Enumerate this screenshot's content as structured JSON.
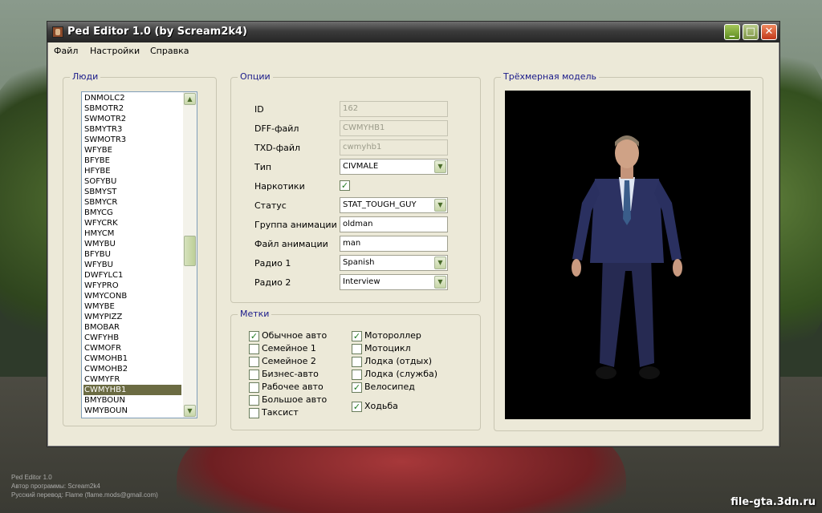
{
  "window": {
    "title": "Ped Editor 1.0 (by Scream2k4)",
    "minimize_label": "_",
    "maximize_label": "□",
    "close_label": "✕"
  },
  "menu": [
    "Файл",
    "Настройки",
    "Справка"
  ],
  "people": {
    "label": "Люди",
    "items": [
      "DNMOLC2",
      "SBMOTR2",
      "SWMOTR2",
      "SBMYTR3",
      "SWMOTR3",
      "WFYBE",
      "BFYBE",
      "HFYBE",
      "SOFYBU",
      "SBMYST",
      "SBMYCR",
      "BMYCG",
      "WFYCRK",
      "HMYCM",
      "WMYBU",
      "BFYBU",
      "WFYBU",
      "DWFYLC1",
      "WFYPRO",
      "WMYCONB",
      "WMYBE",
      "WMYPIZZ",
      "BMOBAR",
      "CWFYHB",
      "CWMOFR",
      "CWMOHB1",
      "CWMOHB2",
      "CWMYFR",
      "CWMYHB1",
      "BMYBOUN",
      "WMYBOUN"
    ],
    "selected": "CWMYHB1",
    "scroll_up": "▲",
    "scroll_down": "▼"
  },
  "options": {
    "label": "Опции",
    "fields": [
      {
        "label": "ID",
        "value": "162",
        "kind": "readonly"
      },
      {
        "label": "DFF-файл",
        "value": "CWMYHB1",
        "kind": "readonly"
      },
      {
        "label": "TXD-файл",
        "value": "cwmyhb1",
        "kind": "readonly"
      },
      {
        "label": "Тип",
        "value": "CIVMALE",
        "kind": "combo"
      },
      {
        "label": "Наркотики",
        "value": "✓",
        "kind": "checkbox"
      },
      {
        "label": "Статус",
        "value": "STAT_TOUGH_GUY",
        "kind": "combo"
      },
      {
        "label": "Группа анимации",
        "value": "oldman",
        "kind": "input"
      },
      {
        "label": "Файл анимации",
        "value": "man",
        "kind": "input"
      },
      {
        "label": "Радио 1",
        "value": "Spanish",
        "kind": "combo"
      },
      {
        "label": "Радио 2",
        "value": "Interview",
        "kind": "combo"
      }
    ],
    "combo_arrow": "▼"
  },
  "flags": {
    "label": "Метки",
    "left": [
      {
        "label": "Обычное авто",
        "checked": true
      },
      {
        "label": "Семейное 1",
        "checked": false
      },
      {
        "label": "Семейное 2",
        "checked": false
      },
      {
        "label": "Бизнес-авто",
        "checked": false
      },
      {
        "label": "Рабочее авто",
        "checked": false
      },
      {
        "label": "Большое авто",
        "checked": false
      },
      {
        "label": "Таксист",
        "checked": false
      }
    ],
    "right": [
      {
        "label": "Мотороллер",
        "checked": true
      },
      {
        "label": "Мотоцикл",
        "checked": false
      },
      {
        "label": "Лодка (отдых)",
        "checked": false
      },
      {
        "label": "Лодка (служба)",
        "checked": false
      },
      {
        "label": "Велосипед",
        "checked": true
      },
      {
        "label": "Ходьба",
        "checked": true
      }
    ],
    "check_mark": "✓"
  },
  "model": {
    "label": "Трёхмерная модель",
    "colors": {
      "suit": "#2a2f5c",
      "skin": "#c99a80",
      "background": "#000000"
    }
  },
  "credits": [
    "Ped Editor 1.0",
    "Автор программы: Scream2k4",
    "Русский перевод: Flame (flame.mods@gmail.com)"
  ],
  "site": "file-gta.3dn.ru"
}
